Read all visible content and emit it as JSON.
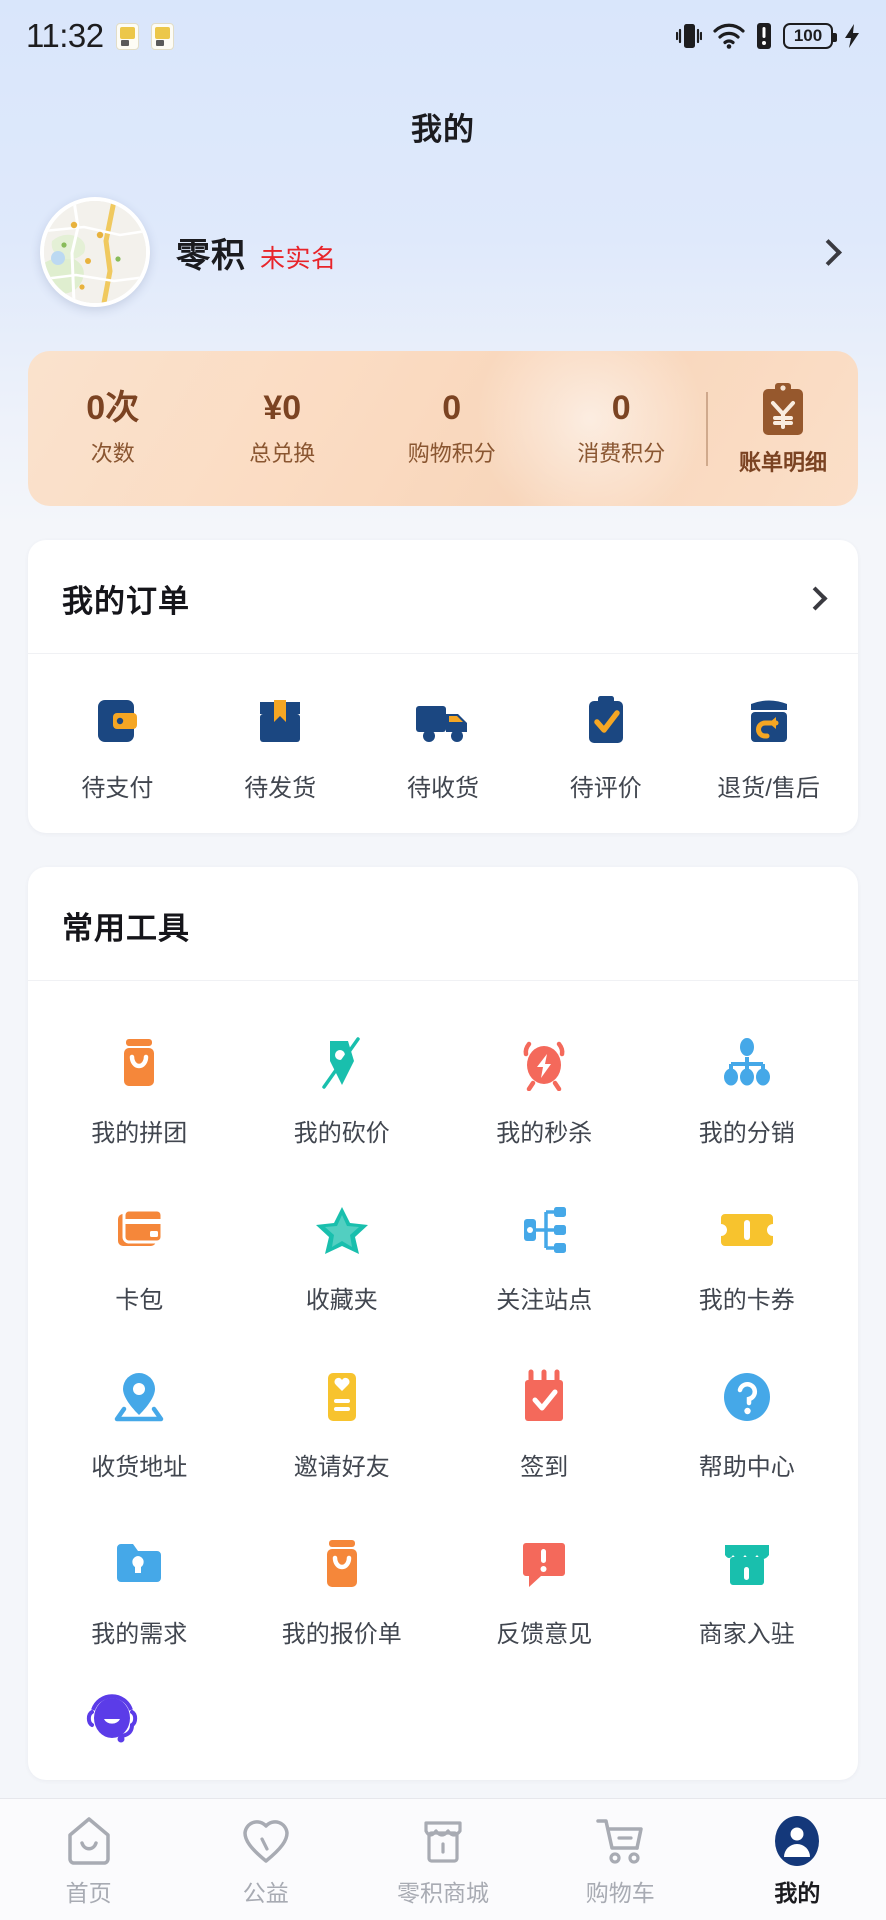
{
  "statusbar": {
    "time": "11:32",
    "battery_level": "100",
    "icons": [
      "sim-card-icon",
      "sim-card-icon",
      "vibrate-icon",
      "wifi-icon",
      "alert-icon",
      "battery-icon",
      "charging-bolt-icon"
    ]
  },
  "header": {
    "title": "我的"
  },
  "profile": {
    "name": "零积",
    "badge": "未实名",
    "badge_color": "#e8242a",
    "avatar_name": "user-avatar-map-image"
  },
  "stats": {
    "items": [
      {
        "value": "0次",
        "label": "次数"
      },
      {
        "value": "¥0",
        "label": "总兑换"
      },
      {
        "value": "0",
        "label": "购物积分"
      },
      {
        "value": "0",
        "label": "消费积分"
      }
    ],
    "bill": {
      "label": "账单明细",
      "icon": "bill-clipboard-yuan-icon"
    },
    "accent_color": "#7b4322",
    "bg_color": "#f9dcc3"
  },
  "orders": {
    "title": "我的订单",
    "icon_color": "#1b4781",
    "accent_color": "#f5a623",
    "items": [
      {
        "label": "待支付",
        "icon": "wallet-icon"
      },
      {
        "label": "待发货",
        "icon": "package-icon"
      },
      {
        "label": "待收货",
        "icon": "truck-icon"
      },
      {
        "label": "待评价",
        "icon": "clipboard-check-icon"
      },
      {
        "label": "退货/售后",
        "icon": "return-box-icon"
      }
    ]
  },
  "tools": {
    "title": "常用工具",
    "items": [
      {
        "label": "我的拼团",
        "icon": "group-buy-bag-icon",
        "color": "#f5873a"
      },
      {
        "label": "我的砍价",
        "icon": "bargain-tag-icon",
        "color": "#19bfad"
      },
      {
        "label": "我的秒杀",
        "icon": "flash-sale-alarm-icon",
        "color": "#f4695b"
      },
      {
        "label": "我的分销",
        "icon": "distribution-tree-icon",
        "color": "#45a8e8"
      },
      {
        "label": "卡包",
        "icon": "card-wallet-icon",
        "color": "#f5873a"
      },
      {
        "label": "收藏夹",
        "icon": "star-favorite-icon",
        "color": "#19bfad"
      },
      {
        "label": "关注站点",
        "icon": "sitemap-follow-icon",
        "color": "#45a8e8"
      },
      {
        "label": "我的卡券",
        "icon": "coupon-ticket-icon",
        "color": "#f7c32e"
      },
      {
        "label": "收货地址",
        "icon": "location-pin-icon",
        "color": "#45a8e8"
      },
      {
        "label": "邀请好友",
        "icon": "invite-friend-card-icon",
        "color": "#f7c32e"
      },
      {
        "label": "签到",
        "icon": "calendar-check-icon",
        "color": "#f4695b"
      },
      {
        "label": "帮助中心",
        "icon": "help-question-icon",
        "color": "#45a8e8"
      },
      {
        "label": "我的需求",
        "icon": "demand-folder-icon",
        "color": "#45a8e8"
      },
      {
        "label": "我的报价单",
        "icon": "quotation-bag-icon",
        "color": "#f5873a"
      },
      {
        "label": "反馈意见",
        "icon": "feedback-speech-icon",
        "color": "#f4695b"
      },
      {
        "label": "商家入驻",
        "icon": "merchant-shop-icon",
        "color": "#19bfad"
      }
    ],
    "service_icon": "customer-service-avatar-icon",
    "service_color": "#5b3ce8"
  },
  "tabbar": {
    "active_color": "#14387a",
    "inactive_color": "#a8abb3",
    "items": [
      {
        "label": "首页",
        "icon": "home-icon",
        "active": false
      },
      {
        "label": "公益",
        "icon": "heart-charity-icon",
        "active": false
      },
      {
        "label": "零积商城",
        "icon": "shop-mall-icon",
        "active": false
      },
      {
        "label": "购物车",
        "icon": "shopping-cart-icon",
        "active": false
      },
      {
        "label": "我的",
        "icon": "person-profile-icon",
        "active": true
      }
    ]
  }
}
